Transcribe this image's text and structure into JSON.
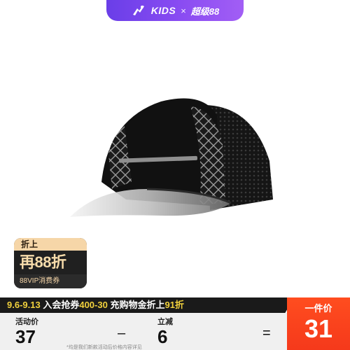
{
  "brand": {
    "kids_label": "KIDS",
    "separator": "×",
    "campaign_label": "超级88",
    "bar_color": "#7a46ee"
  },
  "product": {
    "image_icon": "baseball-cap-image",
    "cap_color": "#111111",
    "visor_color": "#d9d9d9"
  },
  "badge": {
    "top_label": "折上",
    "main_label": "再88折",
    "bottom_label": "88VIP消费券"
  },
  "promo": {
    "date_range": "9.6-9.13",
    "coupon_text": "入会抢券",
    "coupon_value": "400-30",
    "bonus_text": "充购物金折上",
    "bonus_value": "91折"
  },
  "calc": {
    "activity_label": "活动价",
    "activity_value": "37",
    "minus_sign": "–",
    "reduce_label": "立减",
    "reduce_value": "6",
    "equals_sign": "=",
    "fineprint": "*均是我们新款活动后价格内容详见"
  },
  "final": {
    "label": "一件价",
    "value": "31",
    "color": "#f5391b"
  }
}
